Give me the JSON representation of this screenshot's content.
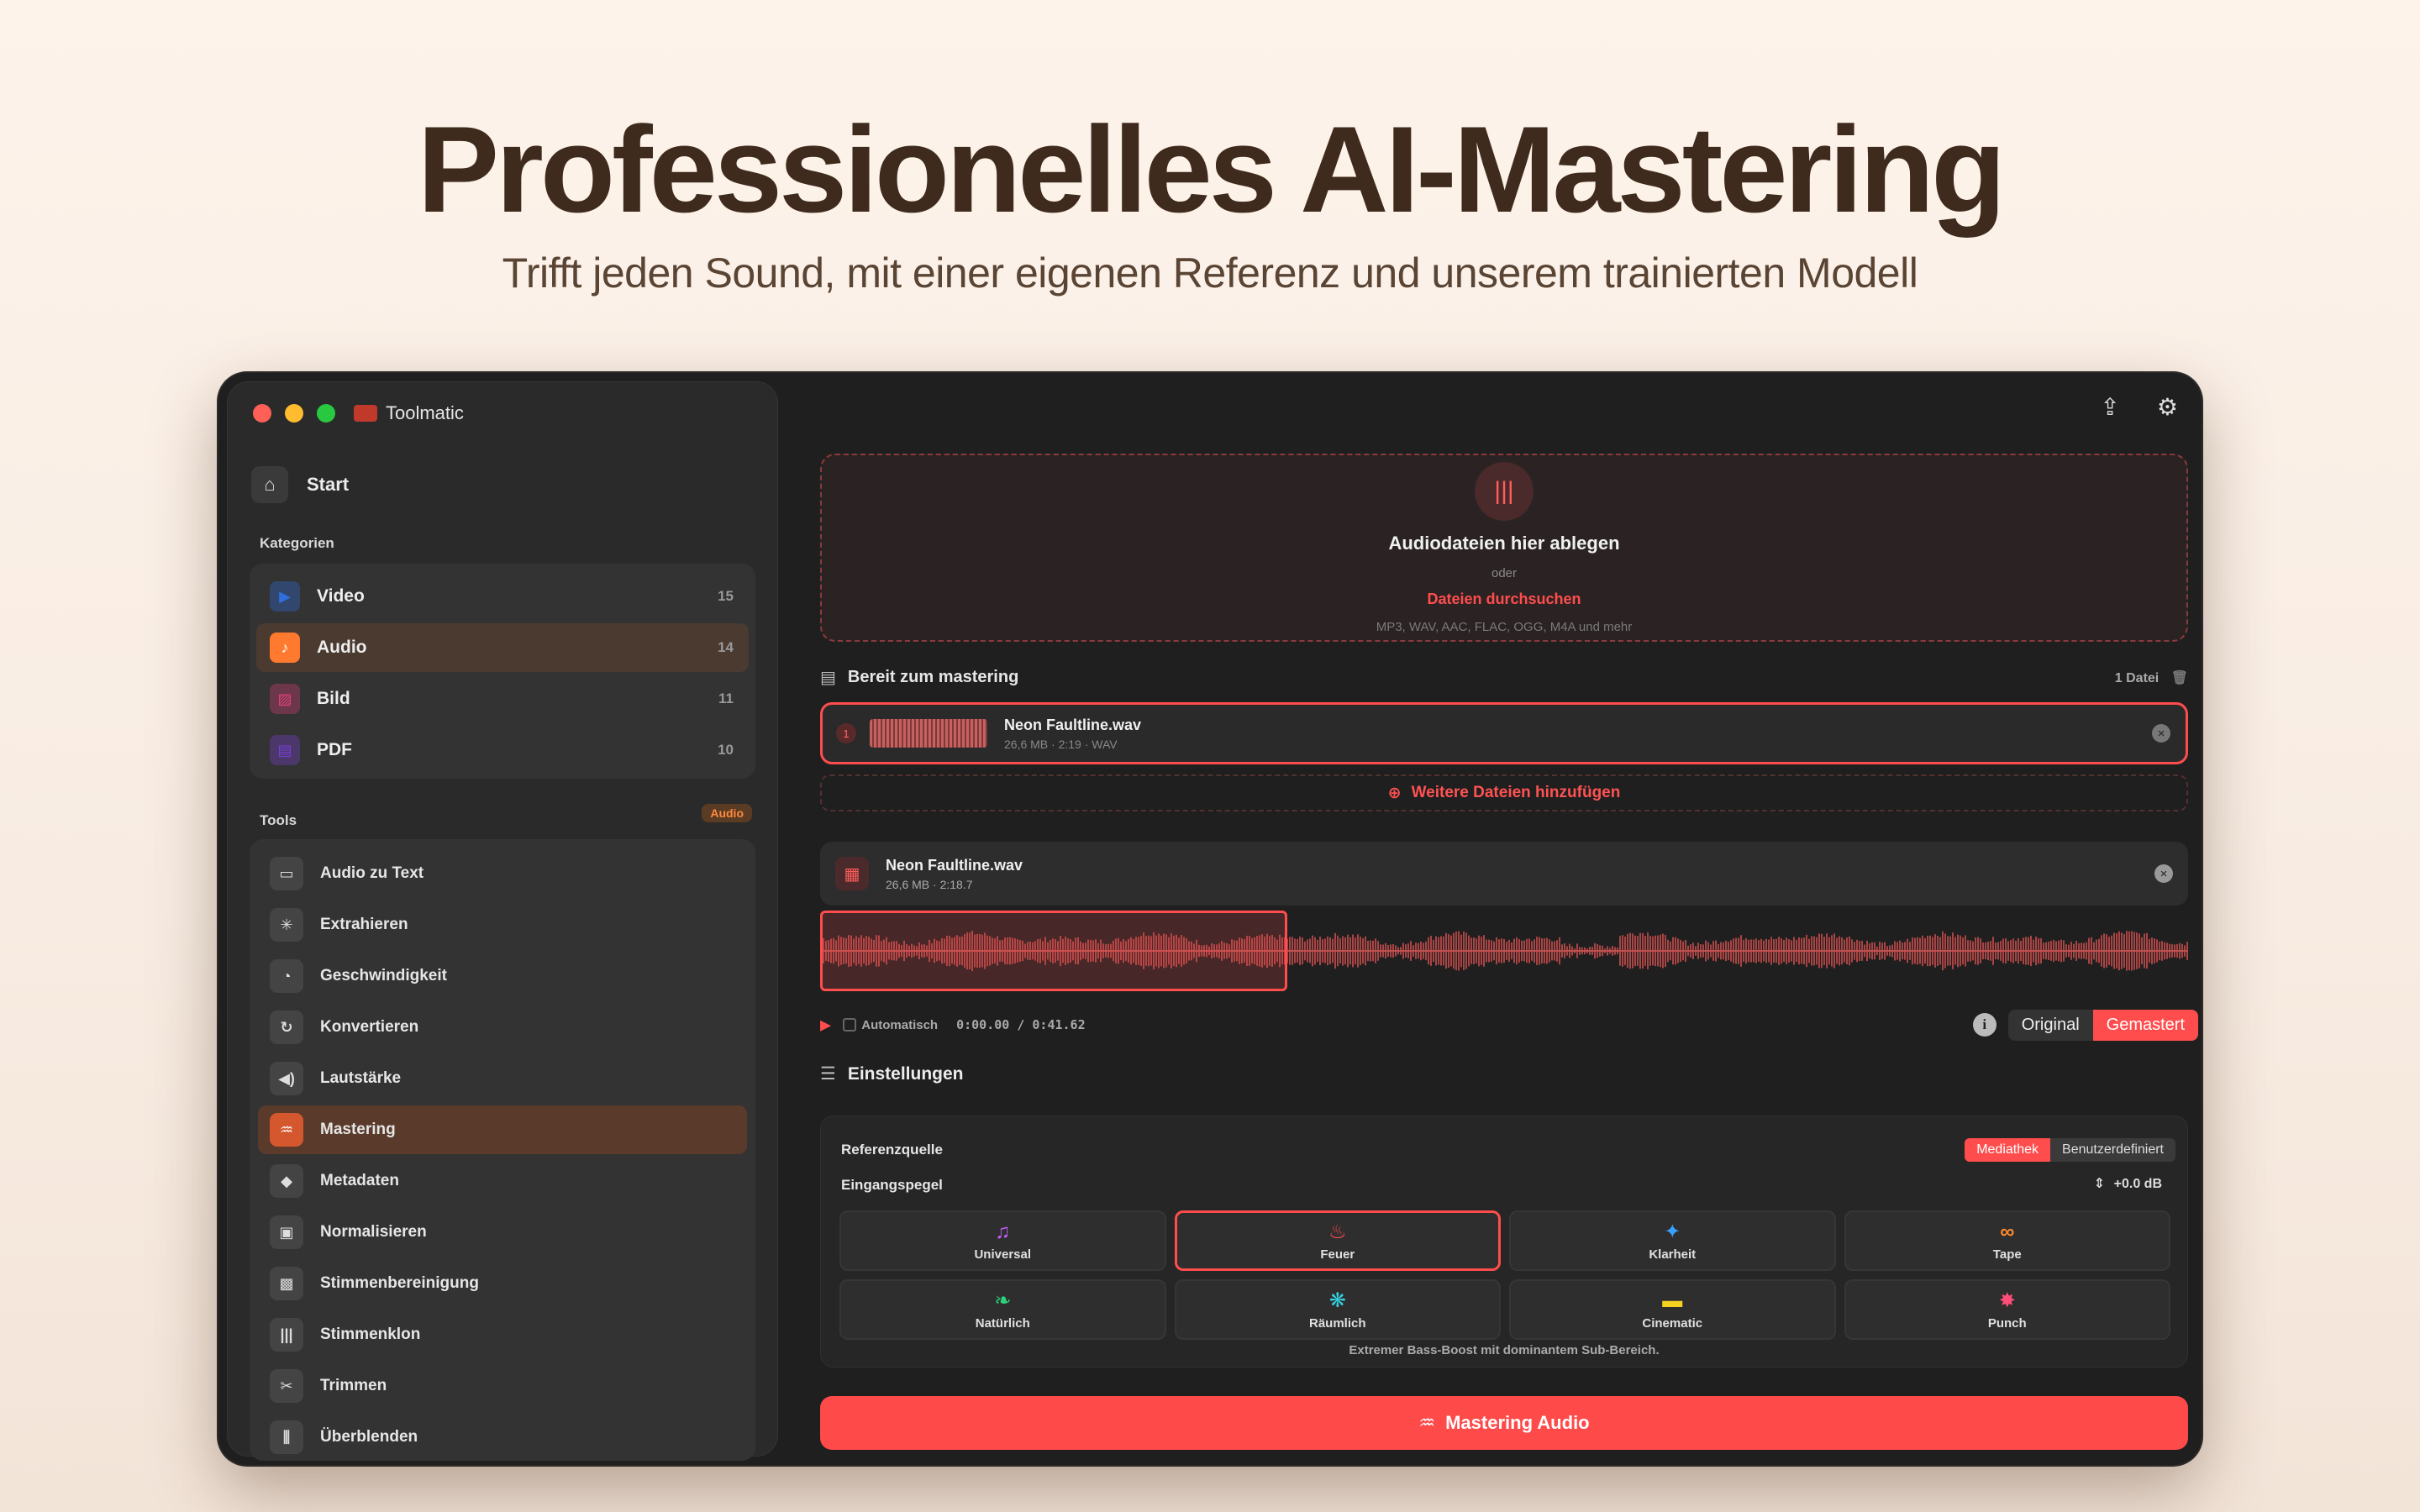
{
  "hero": {
    "title": "Professionelles AI-Mastering",
    "subtitle": "Trifft jeden Sound, mit einer eigenen Referenz und unserem trainierten Modell"
  },
  "app": {
    "name": "Toolmatic"
  },
  "sidebar": {
    "start_label": "Start",
    "categories_label": "Kategorien",
    "categories": [
      {
        "label": "Video",
        "count": "15",
        "icon": "video-icon",
        "color": "#2f6fe0"
      },
      {
        "label": "Audio",
        "count": "14",
        "icon": "music-note-icon",
        "color": "#ff7a2f"
      },
      {
        "label": "Bild",
        "count": "11",
        "icon": "image-icon",
        "color": "#e0407a"
      },
      {
        "label": "PDF",
        "count": "10",
        "icon": "pdf-icon",
        "color": "#7a3fd6"
      }
    ],
    "tools_label": "Tools",
    "tools_badge": "Audio",
    "tools": [
      {
        "label": "Audio zu Text",
        "icon": "speech-bubble-icon"
      },
      {
        "label": "Extrahieren",
        "icon": "waveform-icon"
      },
      {
        "label": "Geschwindigkeit",
        "icon": "speedometer-icon"
      },
      {
        "label": "Konvertieren",
        "icon": "convert-icon"
      },
      {
        "label": "Lautstärke",
        "icon": "speaker-icon"
      },
      {
        "label": "Mastering",
        "icon": "mastering-icon"
      },
      {
        "label": "Metadaten",
        "icon": "tag-icon"
      },
      {
        "label": "Normalisieren",
        "icon": "normalize-icon"
      },
      {
        "label": "Stimmenbereinigung",
        "icon": "voice-clean-icon"
      },
      {
        "label": "Stimmenklon",
        "icon": "voice-clone-icon"
      },
      {
        "label": "Trimmen",
        "icon": "scissors-icon"
      },
      {
        "label": "Überblenden",
        "icon": "crossfade-icon"
      }
    ]
  },
  "dropzone": {
    "title": "Audiodateien hier ablegen",
    "or": "oder",
    "browse": "Dateien durchsuchen",
    "formats": "MP3, WAV, AAC, FLAC, OGG, M4A und mehr"
  },
  "queue": {
    "title": "Bereit zum mastering",
    "count": "1 Datei",
    "file": {
      "index": "1",
      "name": "Neon Faultline.wav",
      "meta": "26,6 MB · 2:19 · WAV"
    },
    "add_more": "Weitere Dateien hinzufügen"
  },
  "player": {
    "name": "Neon Faultline.wav",
    "meta": "26,6 MB  ·  2:18.7",
    "auto_label": "Automatisch",
    "time": "0:00.00  /  0:41.62",
    "toggle_original": "Original",
    "toggle_mastered": "Gemastert",
    "selection_fraction": 0.3
  },
  "settings": {
    "title": "Einstellungen",
    "ref_label": "Referenzquelle",
    "ref_lib": "Mediathek",
    "ref_custom": "Benutzerdefiniert",
    "gain_label": "Eingangspegel",
    "gain_value": "+0.0 dB",
    "presets": [
      {
        "label": "Universal",
        "glyph": "♫",
        "color": "#c65cff"
      },
      {
        "label": "Feuer",
        "glyph": "♨",
        "color": "#ff4d4d"
      },
      {
        "label": "Klarheit",
        "glyph": "✦",
        "color": "#3aa0ff"
      },
      {
        "label": "Tape",
        "glyph": "∞",
        "color": "#ff8a2f"
      },
      {
        "label": "Natürlich",
        "glyph": "❧",
        "color": "#2fd07a"
      },
      {
        "label": "Räumlich",
        "glyph": "❋",
        "color": "#35d0e0"
      },
      {
        "label": "Cinematic",
        "glyph": "▬",
        "color": "#f5d21f"
      },
      {
        "label": "Punch",
        "glyph": "✸",
        "color": "#ff4d7a"
      }
    ],
    "preset_desc": "Extremer Bass-Boost mit dominantem Sub-Bereich."
  },
  "action": {
    "label": "Mastering Audio"
  }
}
